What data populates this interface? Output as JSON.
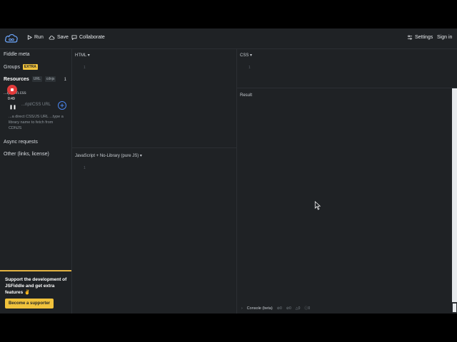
{
  "topbar": {
    "run_label": "Run",
    "save_label": "Save",
    "collaborate_label": "Collaborate",
    "settings_label": "Settings",
    "signin_label": "Sign in"
  },
  "sidebar": {
    "fiddle_meta": "Fiddle meta",
    "groups": "Groups",
    "groups_badge": "EXTRA",
    "resources": "Resources",
    "resources_tab_url": "URL",
    "resources_tab_cdnjs": "cdnjs",
    "resources_count": "1",
    "resource_file": "...ip.min.css",
    "resource_input_placeholder": "...ript/CSS URL",
    "resource_help": "...a direct CSS/JS URL ...type a library name to fetch from CDNJS",
    "async_requests": "Async requests",
    "other": "Other (links, license)"
  },
  "recorder": {
    "time": "0:49"
  },
  "support": {
    "text": "Support the development of JSFiddle and get extra features ✌",
    "button": "Become a supporter"
  },
  "panes": {
    "html_label": "HTML ▾",
    "css_label": "CSS ▾",
    "js_label": "JavaScript + No-Library (pure JS) ▾",
    "result_label": "Result",
    "line_one": "1"
  },
  "console": {
    "label": "Console (beta)",
    "count_errors": "0",
    "count_warnings": "0",
    "count_info": "0",
    "count_logs": "0"
  },
  "colors": {
    "background": "#1f2225",
    "accent": "#f0c23c",
    "link_blue": "#4a86f0",
    "record_red": "#e23b3b"
  }
}
